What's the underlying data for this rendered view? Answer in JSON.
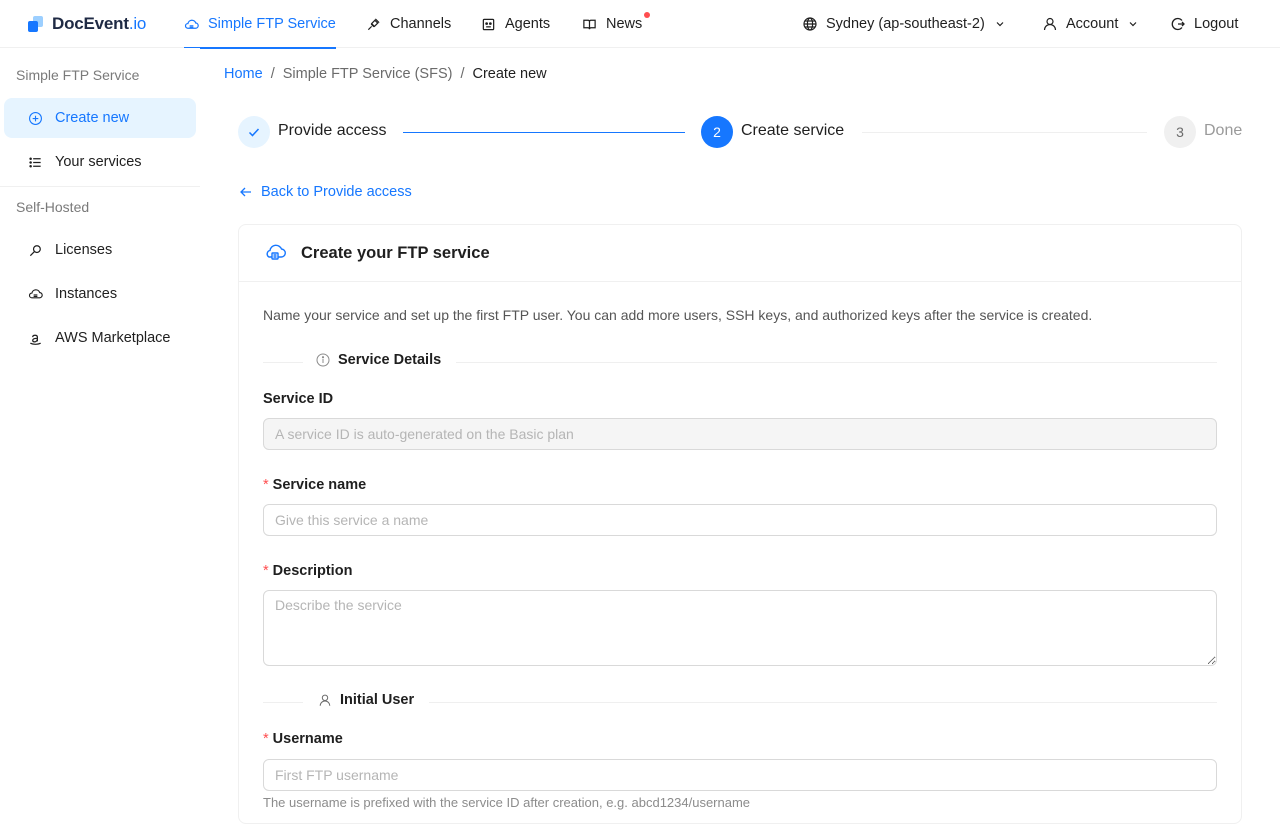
{
  "brand": {
    "name": "DocEvent",
    "suffix": ".io",
    "color": "#1677ff"
  },
  "topnav": {
    "items": [
      {
        "label": "Simple FTP Service",
        "icon": "cloud-icon",
        "active": true
      },
      {
        "label": "Channels",
        "icon": "plug-icon"
      },
      {
        "label": "Agents",
        "icon": "agent-icon"
      },
      {
        "label": "News",
        "icon": "book-icon",
        "badge_dot": true
      }
    ],
    "region": {
      "label": "Sydney (ap-southeast-2)",
      "icon": "globe-icon"
    },
    "account": {
      "label": "Account",
      "icon": "user-icon"
    },
    "logout": {
      "label": "Logout",
      "icon": "logout-icon"
    }
  },
  "sidebar": {
    "groups": [
      {
        "title": "Simple FTP Service",
        "items": [
          {
            "label": "Create new",
            "icon": "plus-circle-icon",
            "active": true
          },
          {
            "label": "Your services",
            "icon": "list-icon"
          }
        ]
      },
      {
        "title": "Self-Hosted",
        "items": [
          {
            "label": "Licenses",
            "icon": "key-icon"
          },
          {
            "label": "Instances",
            "icon": "cloud-server-icon"
          },
          {
            "label": "AWS Marketplace",
            "icon": "amazon-icon"
          }
        ]
      }
    ]
  },
  "breadcrumb": {
    "home": "Home",
    "parent": "Simple FTP Service (SFS)",
    "current": "Create new",
    "separator": "/"
  },
  "steps": [
    {
      "number": "",
      "title": "Provide access",
      "status": "finished"
    },
    {
      "number": "2",
      "title": "Create service",
      "status": "process"
    },
    {
      "number": "3",
      "title": "Done",
      "status": "wait"
    }
  ],
  "back_link": {
    "label": "Back to Provide access"
  },
  "card": {
    "title": "Create your FTP service",
    "intro": "Name your service and set up the first FTP user. You can add more users, SSH keys, and authorized keys after the service is created.",
    "sections": {
      "details": {
        "title": "Service Details"
      },
      "user": {
        "title": "Initial User"
      }
    },
    "fields": {
      "service_id": {
        "label": "Service ID",
        "placeholder": "A service ID is auto-generated on the Basic plan",
        "value": ""
      },
      "service_name": {
        "label": "Service name",
        "placeholder": "Give this service a name",
        "value": "",
        "required": true
      },
      "description": {
        "label": "Description",
        "placeholder": "Describe the service",
        "value": "",
        "required": true
      },
      "username": {
        "label": "Username",
        "placeholder": "First FTP username",
        "value": "",
        "required": true,
        "help": "The username is prefixed with the service ID after creation, e.g. abcd1234/username"
      }
    }
  }
}
